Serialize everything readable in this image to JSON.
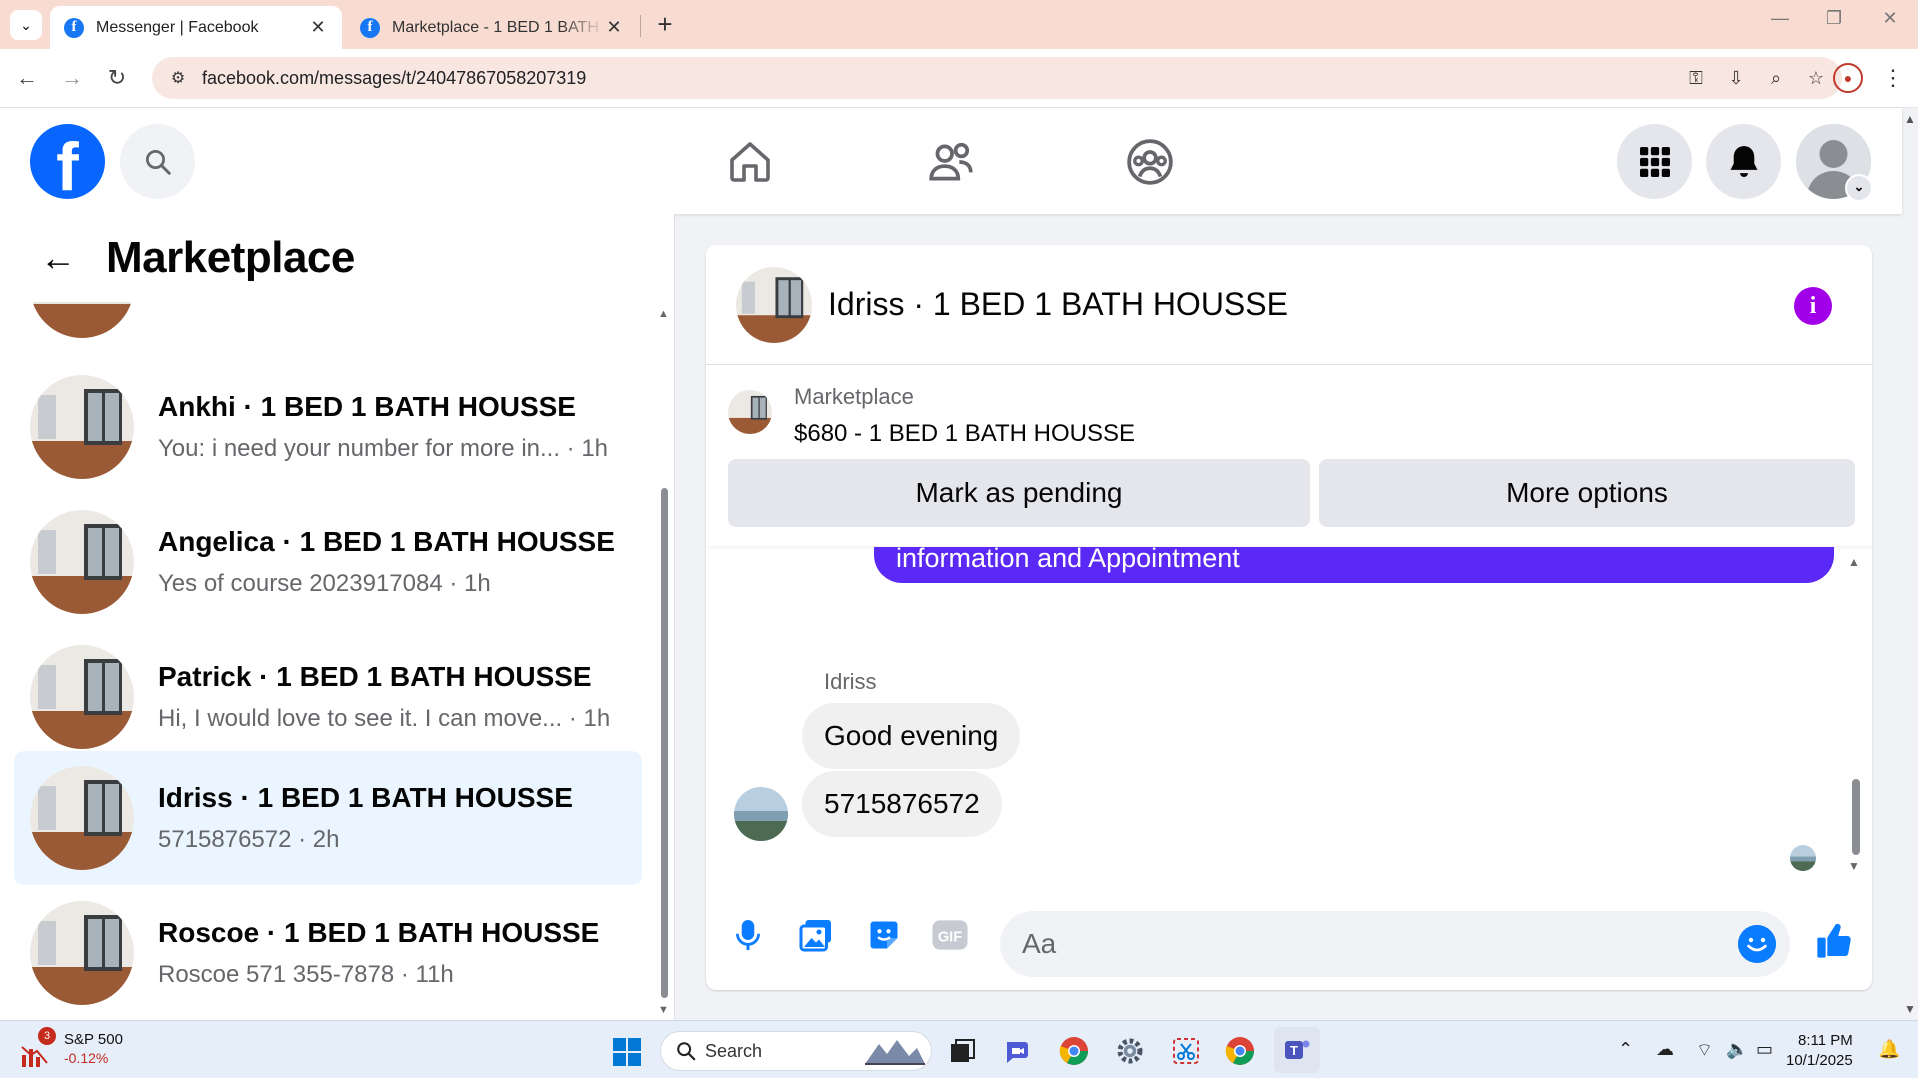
{
  "browser": {
    "tabs": [
      {
        "title": "Messenger | Facebook",
        "active": true
      },
      {
        "title": "Marketplace - 1 BED 1 BATH HOUSSE",
        "active": false
      }
    ],
    "url": "facebook.com/messages/t/24047867058207319"
  },
  "left_panel": {
    "title": "Marketplace",
    "conversations": [
      {
        "name": "Ankhi · 1 BED 1 BATH HOUSSE",
        "snippet": "You: i need your number for more in... · 1h",
        "selected": false
      },
      {
        "name": "Angelica · 1 BED 1 BATH HOUSSE",
        "snippet": "Yes of course 2023917084 · 1h",
        "selected": false
      },
      {
        "name": "Patrick · 1 BED 1 BATH HOUSSE",
        "snippet": "Hi, I would love to see it. I can move... · 1h",
        "selected": false
      },
      {
        "name": "Idriss · 1 BED 1 BATH HOUSSE",
        "snippet": "5715876572 · 2h",
        "selected": true
      },
      {
        "name": "Roscoe · 1 BED 1 BATH HOUSSE",
        "snippet": "Roscoe 571 355-7878 · 11h",
        "selected": false
      }
    ]
  },
  "chat": {
    "title": "Idriss · 1 BED 1 BATH HOUSSE",
    "listing": {
      "source": "Marketplace",
      "title": "$680 - 1 BED 1 BATH HOUSSE"
    },
    "actions": {
      "mark_pending": "Mark as pending",
      "more_options": "More options"
    },
    "messages": {
      "sent_partial": "information and Appointment",
      "sender": "Idriss",
      "received": [
        "Good evening",
        "5715876572"
      ]
    },
    "composer_placeholder": "Aa",
    "accent": "#0a7cff",
    "sent_bubble_color": "#5b29f5"
  },
  "taskbar": {
    "stock_name": "S&P 500",
    "stock_change": "-0.12%",
    "stock_badge": "3",
    "search_label": "Search",
    "time": "8:11 PM",
    "date": "10/1/2025"
  }
}
